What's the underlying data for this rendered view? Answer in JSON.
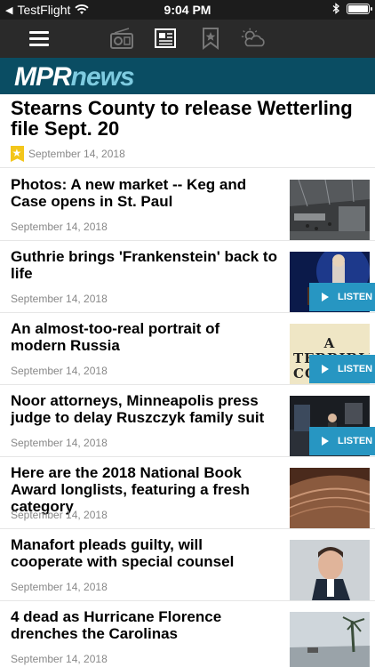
{
  "status": {
    "carrier": "TestFlight",
    "time": "9:04 PM"
  },
  "brand": {
    "mpr": "MPR",
    "news": "news"
  },
  "lead": {
    "title": "Stearns County to release Wetterling file Sept. 20",
    "date": "September 14, 2018"
  },
  "listen_label": "LISTEN",
  "stories": [
    {
      "title": "Photos: A new market -- Keg and Case opens in St. Paul",
      "date": "September 14, 2018"
    },
    {
      "title": "Guthrie brings 'Frankenstein' back to life",
      "date": "September 14, 2018"
    },
    {
      "title": "An almost-too-real portrait of modern Russia",
      "date": "September 14, 2018",
      "thumb_text": "A TERRIBLE COUNTRY"
    },
    {
      "title": "Noor attorneys, Minneapolis press judge to delay Ruszczyk family suit",
      "date": "September 14, 2018"
    },
    {
      "title": "Here are the 2018 National Book Award longlists, featuring a fresh category",
      "date": "September 14, 2018"
    },
    {
      "title": "Manafort pleads guilty, will cooperate with special counsel",
      "date": "September 14, 2018"
    },
    {
      "title": "4 dead as Hurricane Florence drenches the Carolinas",
      "date": "September 14, 2018"
    }
  ],
  "icons": [
    "menu-icon",
    "radio-icon",
    "news-icon",
    "bookmark-icon",
    "weather-icon",
    "wifi-icon",
    "bluetooth-icon",
    "battery-icon"
  ]
}
